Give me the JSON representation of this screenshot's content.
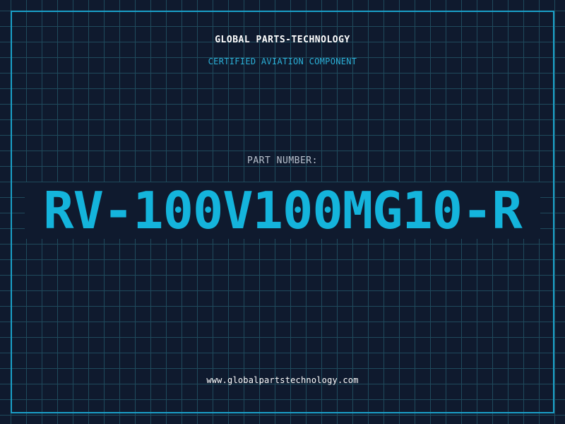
{
  "header": {
    "brand": "GLOBAL PARTS-TECHNOLOGY",
    "subtitle": "CERTIFIED AVIATION COMPONENT"
  },
  "part": {
    "label": "PART NUMBER:",
    "number": "RV-100V100MG10-R"
  },
  "footer": {
    "url": "www.globalpartstechnology.com"
  },
  "colors": {
    "background": "#0f1a2e",
    "grid": "#1f4a5c",
    "accent": "#14b4dc",
    "frame": "#1aa0c8",
    "text": "#ffffff"
  }
}
